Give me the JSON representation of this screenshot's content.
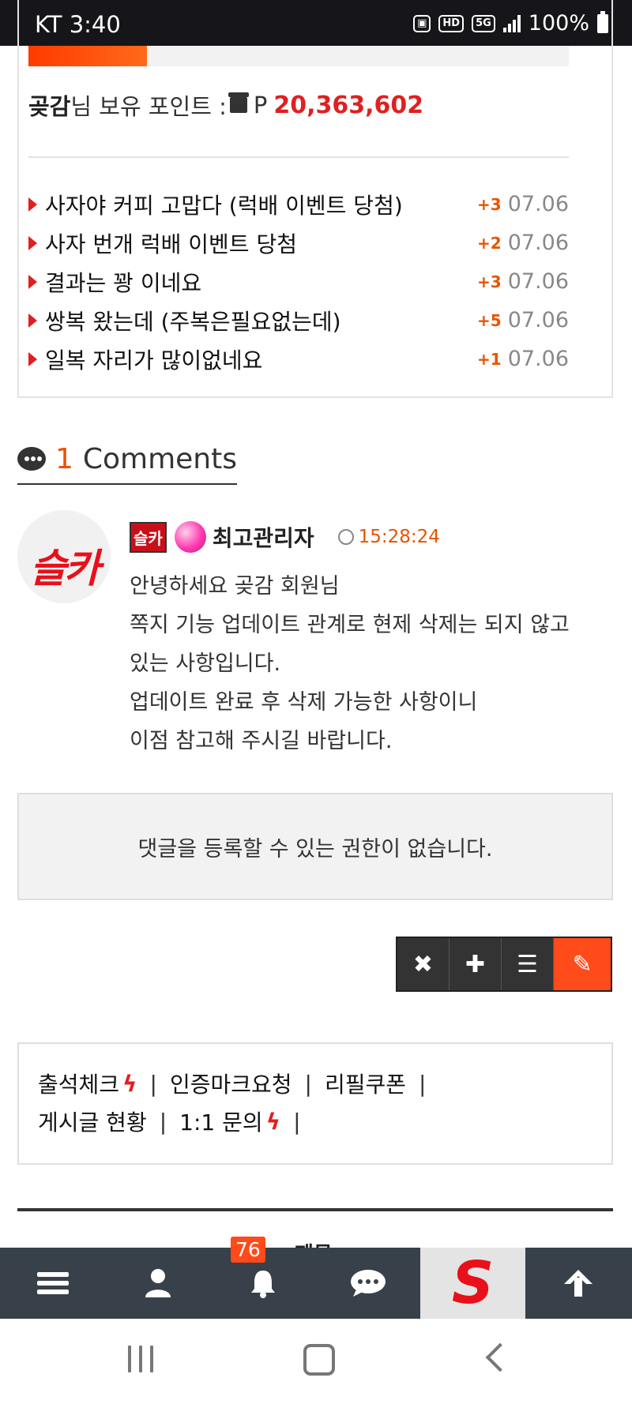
{
  "statusbar": {
    "carrier_time": "KT 3:40",
    "hd": "HD",
    "network": "5G",
    "battery": "100%"
  },
  "progress": {
    "fill_percent": 22
  },
  "points": {
    "nickname": "곶감",
    "suffix": "님 보유 포인트 :",
    "currency": "P",
    "value": "20,363,602"
  },
  "recent_posts": [
    {
      "title": "사자야 커피 고맙다 (럭배 이벤트 당첨)",
      "points": "+3",
      "date": "07.06"
    },
    {
      "title": "사자 번개 럭배 이벤트 당첨",
      "points": "+2",
      "date": "07.06"
    },
    {
      "title": "결과는 꽝 이네요",
      "points": "+3",
      "date": "07.06"
    },
    {
      "title": "쌍복 왔는데 (주복은필요없는데)",
      "points": "+5",
      "date": "07.06"
    },
    {
      "title": "일복 자리가 많이없네요",
      "points": "+1",
      "date": "07.06"
    }
  ],
  "comments_header": {
    "count": "1",
    "label": "Comments"
  },
  "comment": {
    "avatar_text": "슬카",
    "level_badge": "슬카",
    "author": "최고관리자",
    "time": "15:28:24",
    "lines": [
      "안녕하세요 곶감 회원님",
      "쪽지 기능 업데이트 관계로 현제 삭제는 되지 않고",
      "있는 사항입니다.",
      "업데이트 완료 후 삭제 가능한 사항이니",
      "이점 참고해 주시길 바랍니다."
    ]
  },
  "no_permission": "댓글을 등록할 수 있는 권한이 없습니다.",
  "actions": {
    "close": "✖",
    "add": "✚",
    "list": "☰",
    "edit": "✎"
  },
  "quicklinks": {
    "attendance": "출석체크",
    "cert_request": "인증마크요청",
    "refill_coupon": "리필쿠폰",
    "post_status": "게시글 현황",
    "inquiry": "1:1 문의",
    "separator": "|",
    "bolt": "ϟ"
  },
  "peek_text": "제목",
  "bottomnav": {
    "notification_count": "76",
    "site_logo": "S"
  }
}
